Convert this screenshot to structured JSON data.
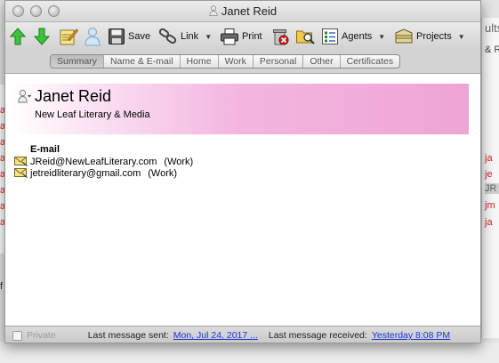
{
  "window": {
    "title": "Janet Reid"
  },
  "toolbar": {
    "save_label": "Save",
    "link_label": "Link",
    "print_label": "Print",
    "agents_label": "Agents",
    "projects_label": "Projects"
  },
  "tabs": [
    "Summary",
    "Name & E-mail",
    "Home",
    "Work",
    "Personal",
    "Other",
    "Certificates"
  ],
  "contact": {
    "name": "Janet Reid",
    "company": "New Leaf Literary & Media",
    "email_heading": "E-mail",
    "emails": [
      {
        "address": "JReid@NewLeafLiterary.com",
        "type": "(Work)"
      },
      {
        "address": "jetreidliterary@gmail.com",
        "type": "(Work)"
      }
    ]
  },
  "footer": {
    "private_label": "Private",
    "last_sent_label": "Last message sent:",
    "last_sent_value": "Mon, Jul 24, 2017 ...",
    "last_received_label": "Last message received:",
    "last_received_value": "Yesterday 8:08 PM"
  },
  "background": {
    "right_fragments": [
      "ults",
      "& R",
      "ja",
      "je",
      "JR",
      "jm",
      "ja"
    ],
    "left_fragments": [
      "a",
      "a",
      "a",
      "a",
      "a",
      "a",
      "a",
      "a",
      "f"
    ]
  },
  "colors": {
    "header_gradient_end": "#eea4d6",
    "link": "#1a34d6",
    "selected_tab": "#bcbcbc"
  }
}
